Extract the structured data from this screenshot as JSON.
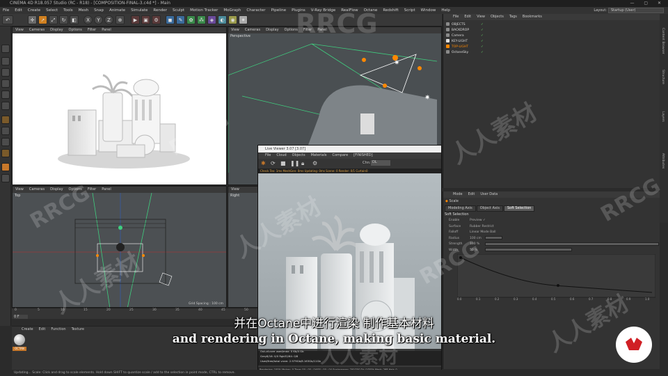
{
  "app": {
    "title": "CINEMA 4D R18.057 Studio (RC - R18) - [COMPOSITION-FINAL-3.c4d *] - Main",
    "window_controls": "— ▢ ✕",
    "layout_label": "Layout:",
    "layout_value": "Startup (User)"
  },
  "menu": [
    "File",
    "Edit",
    "Create",
    "Select",
    "Tools",
    "Mesh",
    "Snap",
    "Animate",
    "Simulate",
    "Render",
    "Sculpt",
    "Motion Tracker",
    "MoGraph",
    "Character",
    "Pipeline",
    "Plugins",
    "V-Ray Bridge",
    "RealFlow",
    "Octane",
    "Redshift",
    "Script",
    "Window",
    "Help"
  ],
  "toolbar": {
    "undo": "↶",
    "x": "X",
    "y": "Y",
    "z": "Z"
  },
  "viewport_menu": [
    "View",
    "Cameras",
    "Display",
    "Options",
    "Filter",
    "Panel"
  ],
  "viewports": {
    "top_left_label": "",
    "top_right_label": "Perspective",
    "bottom_left_label": "Top",
    "bottom_right_label": "Right",
    "grid_spacing": "Grid Spacing : 100 cm"
  },
  "timeline": {
    "ticks": [
      "0",
      "5",
      "10",
      "15",
      "20",
      "25",
      "30",
      "35",
      "40",
      "45",
      "50"
    ],
    "frame": "0 F"
  },
  "material_manager": {
    "menu": [
      "Create",
      "Edit",
      "Function",
      "Texture"
    ],
    "material_name": "OCTAN"
  },
  "object_manager": {
    "menu": [
      "File",
      "Edit",
      "View",
      "Objects",
      "Tags",
      "Bookmarks"
    ],
    "objects": [
      {
        "name": "OBJECTS",
        "color": "#8a8a8a"
      },
      {
        "name": "BACKDROP",
        "color": "#8a8a8a"
      },
      {
        "name": "Camera",
        "color": "#8a8a8a"
      },
      {
        "name": "KEY-LIGHT",
        "color": "#e0e0e0"
      },
      {
        "name": "TOP-LIGHT",
        "color": "#ff8800"
      },
      {
        "name": "OctaneSky",
        "color": "#8a8a8a"
      }
    ]
  },
  "attribute_manager": {
    "menu": [
      "Mode",
      "Edit",
      "User Data"
    ],
    "tool": "Scale",
    "tabs": [
      "Modeling Axis",
      "Object Axis",
      "Soft Selection"
    ],
    "active_tab": "Soft Selection",
    "section": "Soft Selection",
    "rows": [
      {
        "label": "Enable",
        "value": "Preview ✓"
      },
      {
        "label": "Surface",
        "value": "Rubber       Restrict"
      },
      {
        "label": "Falloff",
        "value": "Linear        Mode  Ball"
      },
      {
        "label": "Radius",
        "value": "100 cm"
      },
      {
        "label": "Strength",
        "value": "100 %"
      },
      {
        "label": "Width",
        "value": "50 %"
      }
    ],
    "curve_ticks": [
      "0.0",
      "0.1",
      "0.2",
      "0.3",
      "0.4",
      "0.5",
      "0.6",
      "0.7",
      "0.8",
      "0.9",
      "1.0"
    ]
  },
  "right_tabs": [
    "Content Browser",
    "Structure",
    "Layers",
    "Attributes"
  ],
  "render_window": {
    "title": "Live Viewer 3.07 [3.07]",
    "menu": [
      "File",
      "Cloud",
      "Objects",
      "Materials",
      "Compare",
      "[FINISHED]"
    ],
    "channel": "DL",
    "status": "Check Tex: 1ms  MeshGen: 0ms  Updating: 0ms  Scene: 0  Render: 0/1 Curtain0",
    "stats": [
      "Out-of-core used/max: 0 Kb/4 Gb",
      "Grey8/16: 0/0  Rgb32/64: 0/8",
      "Used/free/total vram: 2.979Gb/8.163Gb/11Gb"
    ],
    "footer": "Rendering: 100%  Ms/sec: 0  Time: 00 : 00 : 04/00 : 00 : 04  Spp/maxspp: 250/250  Tri: 0/355k  Mesh: 268  Hair: 0"
  },
  "status_bar": "Updating...  Scale: Click and drag to scale elements. Hold down SHIFT to quantize scale / add to the selection in point mode, CTRL to remove.",
  "subtitle": {
    "cn": "并在Octane中进行渲染 制作基本材料",
    "en": "and rendering in Octane, making basic material."
  },
  "watermarks": {
    "rrcg": "RRCG",
    "cn": "人人素材"
  },
  "colors": {
    "accent_orange": "#ff8800",
    "selection_blue": "#4a7cc7",
    "grid_green": "#3fcf7f",
    "logo_red": "#d01f25"
  }
}
